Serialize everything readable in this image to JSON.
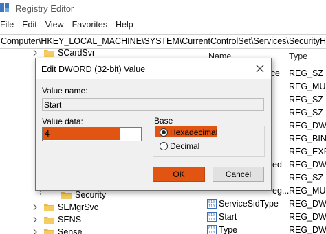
{
  "window": {
    "title": "Registry Editor",
    "icon": "registry-icon"
  },
  "menu": [
    "File",
    "Edit",
    "View",
    "Favorites",
    "Help"
  ],
  "address": "Computer\\HKEY_LOCAL_MACHINE\\SYSTEM\\CurrentControlSet\\Services\\SecurityHealthService",
  "tree": {
    "top_item": "SCardSvr",
    "security_item": "Security",
    "bottom_items": [
      "SEMgrSvc",
      "SENS",
      "Sense"
    ]
  },
  "list": {
    "headers": {
      "name": "Name",
      "type": "Type"
    },
    "partial_rows": [
      {
        "name": "ice",
        "type": "REG_SZ"
      },
      {
        "name": "",
        "type": "REG_MULT"
      },
      {
        "name": "",
        "type": "REG_SZ"
      },
      {
        "name": "",
        "type": "REG_SZ"
      },
      {
        "name": "",
        "type": "REG_DWO"
      },
      {
        "name": "",
        "type": "REG_BINA"
      },
      {
        "name": "",
        "type": "REG_EXPA"
      },
      {
        "name": "ed",
        "type": "REG_DWO"
      },
      {
        "name": "",
        "type": "REG_SZ"
      },
      {
        "name": "eg...",
        "type": "REG_MULT"
      }
    ],
    "rows": [
      {
        "name": "ServiceSidType",
        "type": "REG_DWO",
        "icon": "binary-value-icon"
      },
      {
        "name": "Start",
        "type": "REG_DWO",
        "icon": "binary-value-icon"
      },
      {
        "name": "Type",
        "type": "REG_DWO",
        "icon": "binary-value-icon"
      }
    ]
  },
  "dialog": {
    "title": "Edit DWORD (32-bit) Value",
    "value_name_label": "Value name:",
    "value_name": "Start",
    "value_data_label": "Value data:",
    "value_data": "4",
    "base_label": "Base",
    "base_options": [
      "Hexadecimal",
      "Decimal"
    ],
    "base_selected": "Hexadecimal",
    "ok_label": "OK",
    "cancel_label": "Cancel",
    "highlight_color": "#e25412"
  }
}
